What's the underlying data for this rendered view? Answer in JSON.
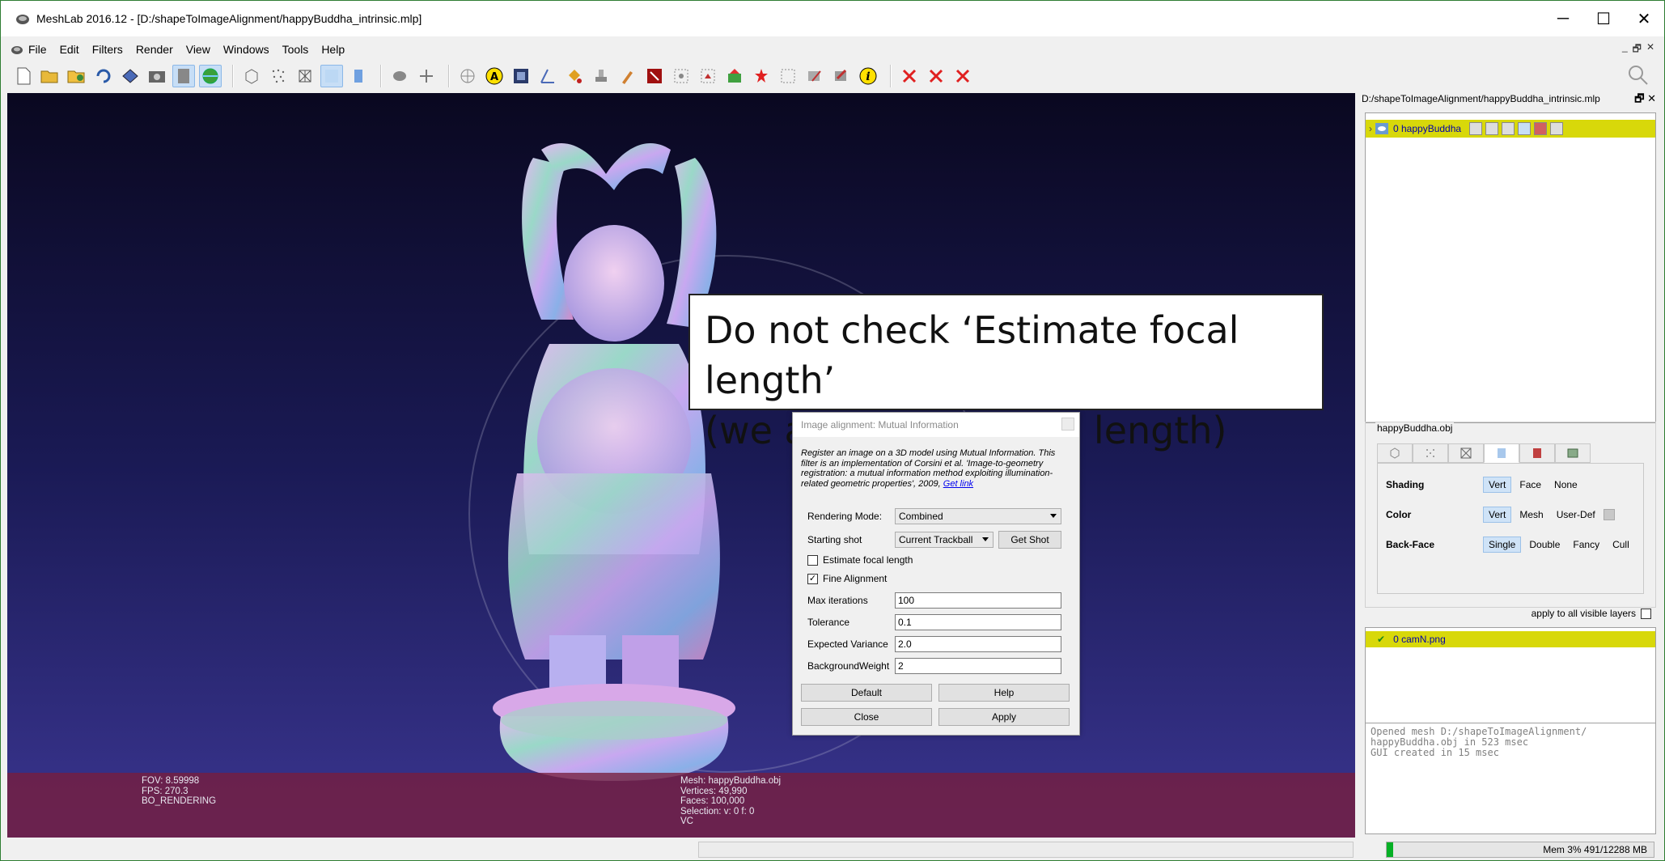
{
  "window": {
    "title": "MeshLab 2016.12 - [D:/shapeToImageAlignment/happyBuddha_intrinsic.mlp]",
    "controls": {
      "minimize": "─",
      "maximize": "☐",
      "close": "✕"
    }
  },
  "menu": {
    "items": [
      "File",
      "Edit",
      "Filters",
      "Render",
      "View",
      "Windows",
      "Tools",
      "Help"
    ],
    "mdi_controls": [
      "_",
      "🗗",
      "✕"
    ]
  },
  "viewport": {
    "info_left": [
      "FOV: 8.59998",
      "FPS:   270.3",
      "BO_RENDERING"
    ],
    "info_mid": [
      "Mesh: happyBuddha.obj",
      "Vertices: 49,990",
      "Faces: 100,000",
      "Selection: v: 0 f: 0",
      "VC"
    ]
  },
  "callout": {
    "line1": "Do not check ‘Estimate focal length’",
    "line2": "(we already fix focal length)"
  },
  "dialog": {
    "title": "Image alignment: Mutual Information",
    "description": "Register an image on a 3D model using Mutual Information. This filter is an implementation of Corsini et al. 'Image-to-geometry registration: a mutual information method exploiting illumination-related geometric properties', 2009,",
    "link": "Get link",
    "rendering_mode_label": "Rendering Mode:",
    "rendering_mode_value": "Combined",
    "starting_shot_label": "Starting shot",
    "starting_shot_value": "Current Trackball",
    "get_shot": "Get Shot",
    "estimate_focal": "Estimate focal length",
    "fine_alignment": "Fine Alignment",
    "max_iter_label": "Max iterations",
    "max_iter_value": "100",
    "tolerance_label": "Tolerance",
    "tolerance_value": "0.1",
    "variance_label": "Expected Variance",
    "variance_value": "2.0",
    "bg_weight_label": "BackgroundWeight",
    "bg_weight_value": "2",
    "default_btn": "Default",
    "help_btn": "Help",
    "close_btn": "Close",
    "apply_btn": "Apply"
  },
  "layers": {
    "panel_title": "D:/shapeToImageAlignment/happyBuddha_intrinsic.mlp",
    "panel_controls": "🗗 ✕",
    "mesh_row": "0  happyBuddha",
    "mesh_group_title": "happyBuddha.obj",
    "shading_label": "Shading",
    "shading_opts": [
      "Vert",
      "Face",
      "None"
    ],
    "color_label": "Color",
    "color_opts": [
      "Vert",
      "Mesh",
      "User-Def"
    ],
    "backface_label": "Back-Face",
    "backface_opts": [
      "Single",
      "Double",
      "Fancy",
      "Cull"
    ],
    "apply_all": "apply to all visible layers",
    "raster_row": "0   camN.png"
  },
  "log": {
    "text": "Opened mesh D:/shapeToImageAlignment/\nhappyBuddha.obj in 523 msec\nGUI created in 15 msec"
  },
  "status": {
    "memory": "Mem 3% 491/12288 MB",
    "memory_percent": 3
  }
}
